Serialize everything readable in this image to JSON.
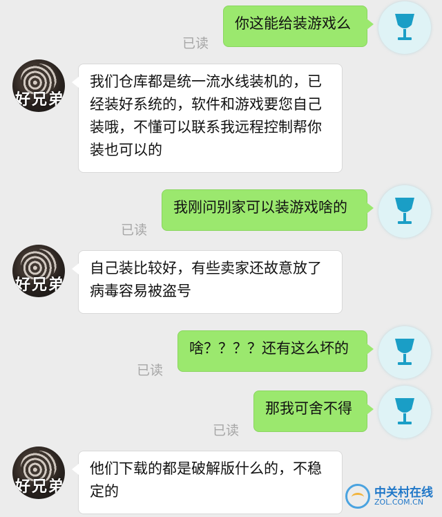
{
  "read_label": "已读",
  "left_avatar_text": "好兄弟",
  "messages": [
    {
      "side": "out",
      "text": "你这能给装游戏么",
      "read": "已读"
    },
    {
      "side": "in",
      "text": "我们仓库都是统一流水线装机的，已经装好系统的，软件和游戏要您自己装哦，不懂可以联系我远程控制帮你装也可以的"
    },
    {
      "side": "out",
      "text": "我刚问别家可以装游戏啥的",
      "read": "已读"
    },
    {
      "side": "in",
      "text": "自己装比较好，有些卖家还故意放了病毒容易被盗号"
    },
    {
      "side": "out",
      "text": "啥？？？？还有这么坏的",
      "read": "已读"
    },
    {
      "side": "out",
      "text": "那我可舍不得",
      "read": "已读"
    },
    {
      "side": "in",
      "text": "他们下载的都是破解版什么的，不稳定的"
    }
  ],
  "watermark": {
    "cn": "中关村在线",
    "en": "ZOL.COM.CN"
  },
  "icons": {
    "right_avatar": "wine-glass-icon",
    "left_avatar": "profile-photo"
  }
}
